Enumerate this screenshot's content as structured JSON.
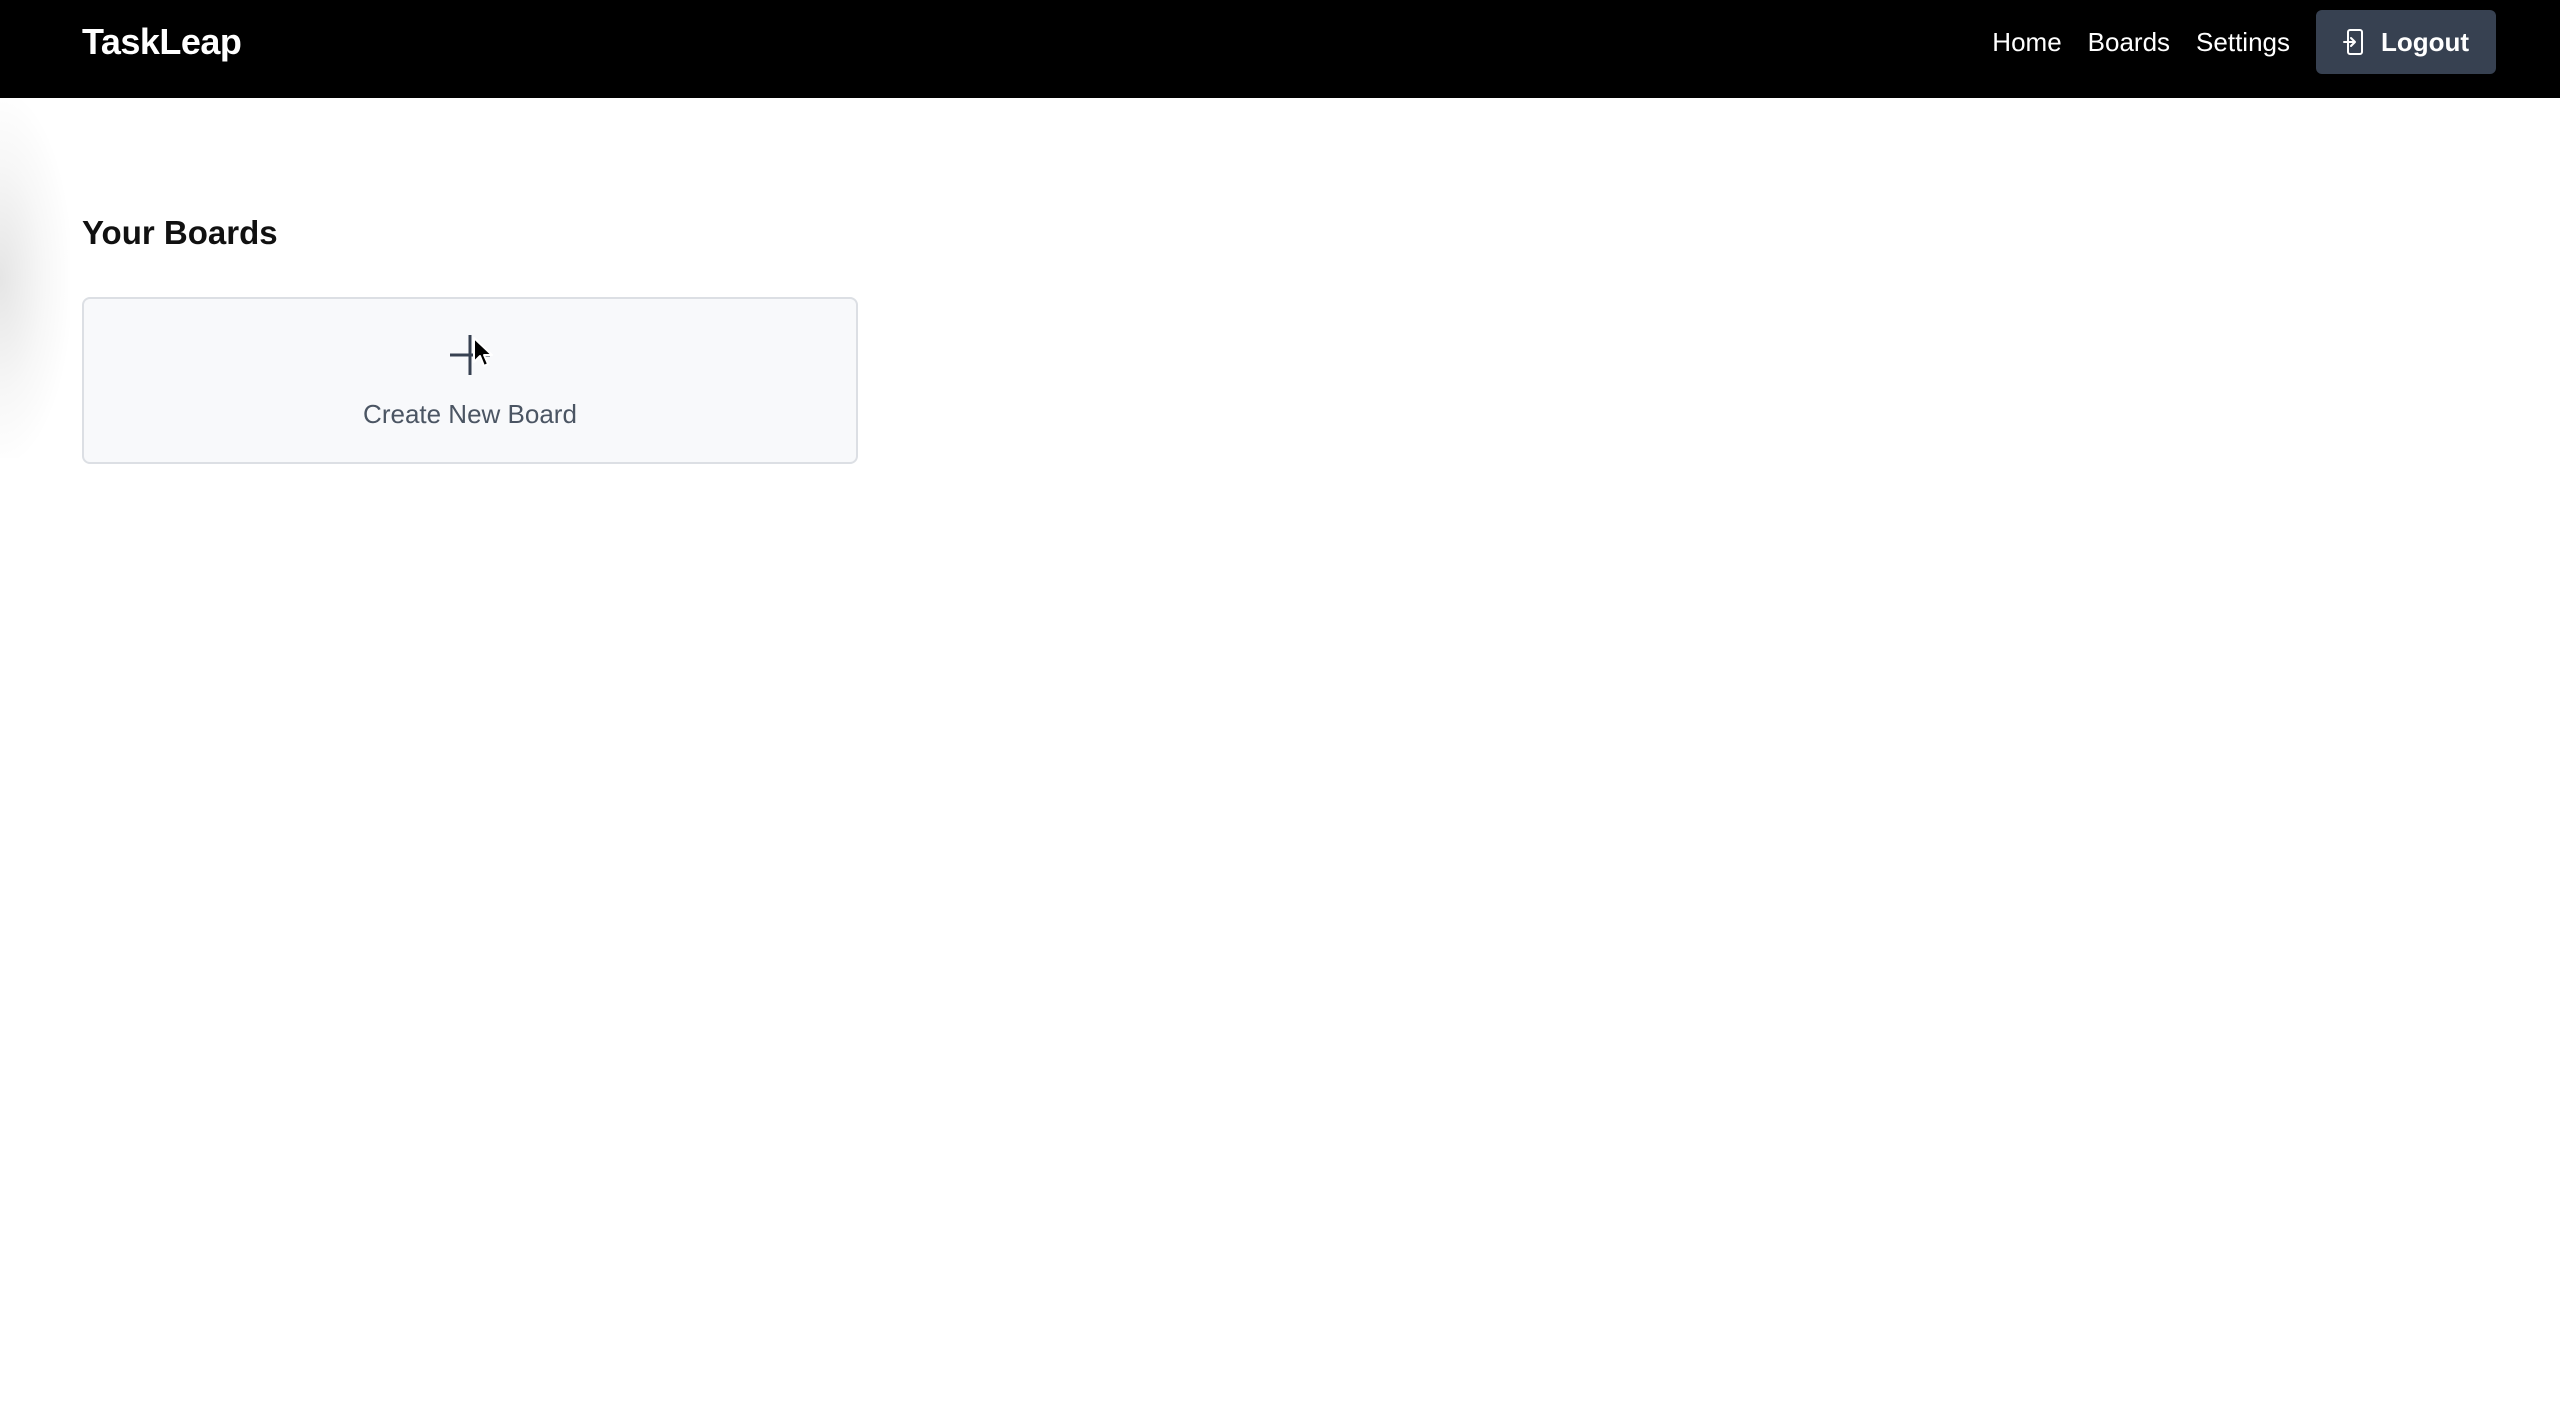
{
  "app": {
    "brand": "TaskLeap"
  },
  "nav": {
    "links": [
      {
        "label": "Home"
      },
      {
        "label": "Boards"
      },
      {
        "label": "Settings"
      }
    ],
    "logout_label": "Logout",
    "logout_icon": "logout-icon"
  },
  "main": {
    "section_title": "Your Boards",
    "create_card": {
      "label": "Create New Board",
      "icon": "plus-icon"
    }
  },
  "colors": {
    "navbar_bg": "#000000",
    "logout_bg": "#374151",
    "card_bg": "#f8f9fb",
    "card_border": "#dcdfe4",
    "card_text": "#4b5563"
  }
}
